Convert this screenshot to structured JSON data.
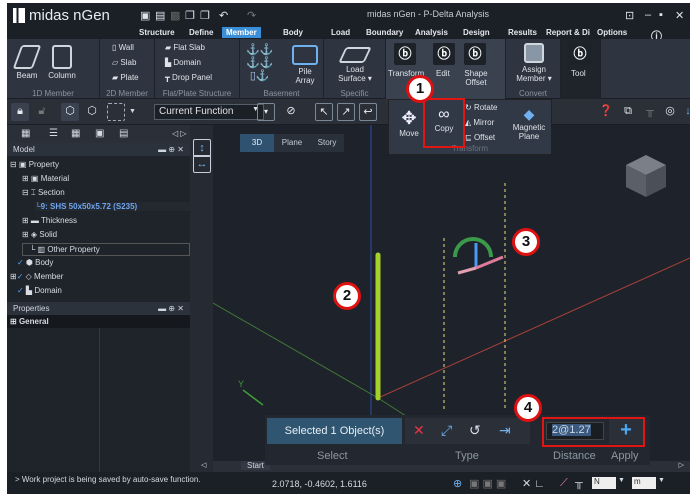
{
  "app": {
    "logo": "midas nGen",
    "title": "midas nGen - P-Delta Analysis"
  },
  "menu": [
    "Structure",
    "Define",
    "Member",
    "Body",
    "Load",
    "Boundary",
    "Analysis",
    "Design",
    "Results",
    "Report & Di",
    "Options"
  ],
  "ribbon": {
    "g1": {
      "label": "1D Member",
      "beam": "Beam",
      "column": "Column"
    },
    "g2": {
      "label": "2D Member",
      "wall": "Wall",
      "slab": "Slab",
      "plate": "Plate"
    },
    "g3": {
      "label": "Flat/Plate Structure",
      "flat_slab": "Flat Slab",
      "domain": "Domain",
      "drop_panel": "Drop Panel"
    },
    "g4": {
      "label": "Basement",
      "pile_array": "Pile Array"
    },
    "g5": {
      "label": "Specific",
      "load_surface": "Load Surface"
    },
    "g6": {
      "transform": "Transform",
      "edit": "Edit",
      "shape_offset": "Shape Offset"
    },
    "g7": {
      "label": "Convert",
      "assign_member": "Assign Member"
    },
    "g8": {
      "tool": "Tool"
    }
  },
  "toolbar": {
    "function_combo": "Current Function"
  },
  "transform_menu": {
    "move": "Move",
    "copy": "Copy",
    "rotate": "Rotate",
    "mirror": "Mirror",
    "offset": "Offset",
    "magnetic_plane": "Magnetic Plane",
    "label": "Transform"
  },
  "left": {
    "model_title": "Model",
    "properties_title": "Properties",
    "general": "General",
    "tree": [
      "Property",
      "Material",
      "Section",
      "9: SHS 50x50x5.72 (S235)",
      "Thickness",
      "Solid",
      "Other Property",
      "Body",
      "Member",
      "Domain"
    ]
  },
  "viewport": {
    "tabs": [
      "3D",
      "Plane",
      "Story"
    ],
    "axis_y": "Y",
    "start_tab": "Start"
  },
  "bottom": {
    "selected": "Selected 1 Object(s)",
    "distance_value": "2@1.27",
    "labels": {
      "select": "Select",
      "type": "Type",
      "distance": "Distance",
      "apply": "Apply"
    }
  },
  "status": {
    "message": "> Work project is being saved by auto-save function.",
    "coords": "2.0718, -0.4602, 1.6116",
    "force_unit": "N",
    "length_unit": "m"
  },
  "badges": [
    "1",
    "2",
    "3",
    "4"
  ]
}
